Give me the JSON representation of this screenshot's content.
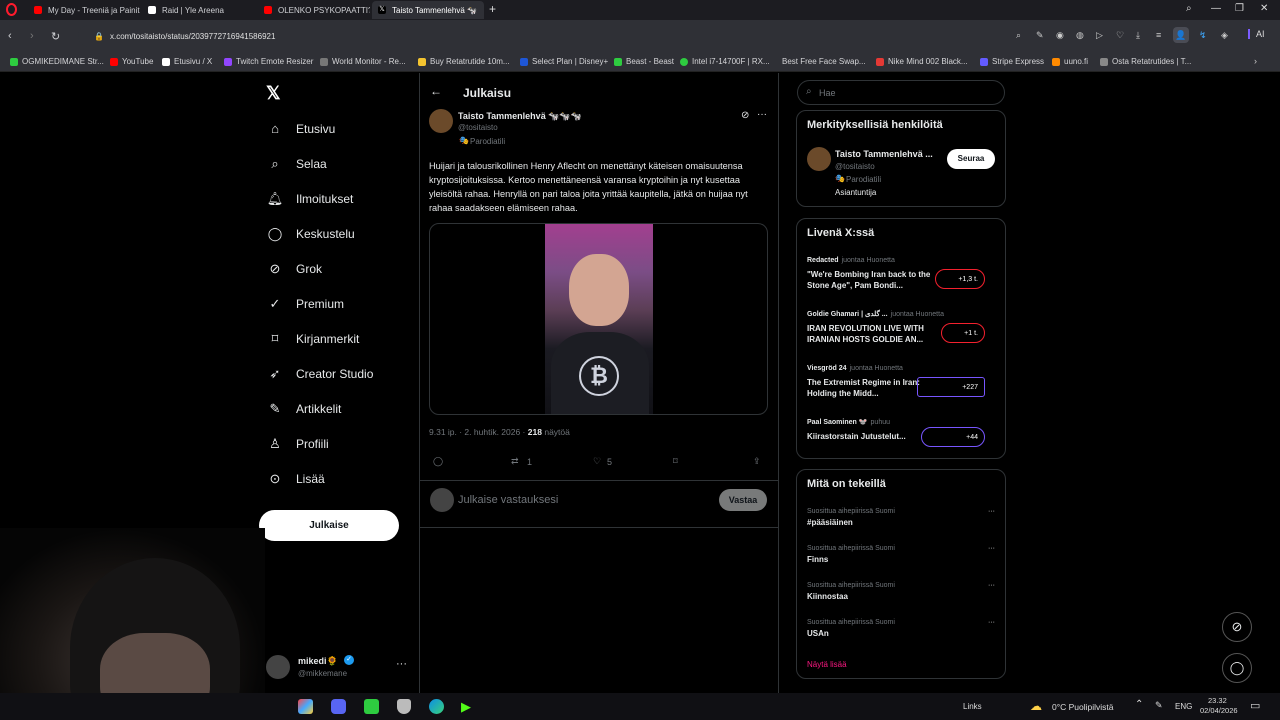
{
  "browser": {
    "tabs": [
      {
        "title": "My Day - Treeniä ja Painit...",
        "active": false
      },
      {
        "title": "Raid | Yle Areena",
        "active": false
      },
      {
        "title": "OLENKO PSYKOPAATTI? f...",
        "active": false
      },
      {
        "title": "Taisto Tammenlehvä 🐄",
        "active": true
      }
    ],
    "url": "x.com/tositaisto/status/2039772716941586921",
    "bookmarks": [
      "OGMIKEDIMANE Str...",
      "YouTube",
      "Etusivu / X",
      "Twitch Emote Resizer",
      "World Monitor - Re...",
      "Buy Retatrutide 10m...",
      "Select Plan | Disney+",
      "Beast - Beast",
      "Intel i7-14700F | RX...",
      "Best Free Face Swap...",
      "Nike Mind 002 Black...",
      "Stripe Express",
      "uuno.fi",
      "Osta Retatrutides | T..."
    ]
  },
  "sidebar": {
    "items": [
      {
        "label": "Etusivu",
        "icon": "home-icon"
      },
      {
        "label": "Selaa",
        "icon": "search-icon"
      },
      {
        "label": "Ilmoitukset",
        "icon": "bell-icon"
      },
      {
        "label": "Keskustelu",
        "icon": "chat-icon"
      },
      {
        "label": "Grok",
        "icon": "grok-icon"
      },
      {
        "label": "Premium",
        "icon": "premium-icon"
      },
      {
        "label": "Kirjanmerkit",
        "icon": "bookmark-icon"
      },
      {
        "label": "Creator Studio",
        "icon": "rocket-icon"
      },
      {
        "label": "Artikkelit",
        "icon": "article-icon"
      },
      {
        "label": "Profiili",
        "icon": "profile-icon"
      },
      {
        "label": "Lisää",
        "icon": "more-icon"
      }
    ],
    "post_button": "Julkaise",
    "account_name": "mikedi🌻",
    "account_handle": "@mikkemane"
  },
  "main": {
    "header": "Julkaisu",
    "author_name": "Taisto Tammenlehvä 🐄🐄🐄",
    "author_handle": "@tositaisto",
    "author_badge": "Parodiatili",
    "text": "Huijari ja talousrikollinen Henry Aflecht on menettänyt käteisen omaisuutensa kryptosijoituksissa. Kertoo menettäneensä varansa kryptoihin ja nyt kusettaa yleisöltä rahaa. Henryllä on pari taloa joita yrittää kaupitella, jätkä on huijaa nyt  rahaa saadakseen elämiseen rahaa.",
    "timestamp": "9.31 ip. · 2. huhtik. 2026 ·",
    "views_count": "218",
    "views_label": "näytöä",
    "actions": {
      "replies": "",
      "reposts": "1",
      "likes": "5"
    },
    "reply_placeholder": "Julkaise vastauksesi",
    "reply_button": "Vastaa"
  },
  "right": {
    "search_placeholder": "Hae",
    "relevant_title": "Merkityksellisiä henkilöitä",
    "relevant_person": {
      "name": "Taisto Tammenlehvä ...",
      "handle": "@tositaisto",
      "badge": "Parodiatili",
      "bio": "Asiantuntija",
      "follow": "Seuraa"
    },
    "live_title": "Livenä X:ssä",
    "live": [
      {
        "host": "Redacted",
        "status": "juontaa Huonetta",
        "title": "\"We're Bombing Iran back to the Stone Age\", Pam Bondi...",
        "count": "+1,3 t."
      },
      {
        "host": "Goldie Ghamari | گلدی ...",
        "status": "juontaa Huonetta",
        "title": "IRAN REVOLUTION LIVE WITH IRANIAN HOSTS GOLDIE AN...",
        "count": "+1 t."
      },
      {
        "host": "Viesgröd 24",
        "status": "juontaa Huonetta",
        "title": "The Extremist Regime in Iran: Holding the Midd...",
        "count": "+227"
      },
      {
        "host": "Paal Saominen 🐭",
        "status": "puhuu",
        "title": "Kiirastorstain Jutustelut...",
        "count": "+44"
      }
    ],
    "whats_title": "Mitä on tekeillä",
    "trends": [
      {
        "context": "Suosittua aihepiirissä Suomi",
        "name": "#pääsiäinen"
      },
      {
        "context": "Suosittua aihepiirissä Suomi",
        "name": "Finns"
      },
      {
        "context": "Suosittua aihepiirissä Suomi",
        "name": "Kiinnostaa"
      },
      {
        "context": "Suosittua aihepiirissä Suomi",
        "name": "USAn"
      }
    ],
    "show_more": "Näytä lisää"
  },
  "taskbar": {
    "links": "Links",
    "weather": "0°C  Puolipilvistä",
    "lang": "ENG",
    "time": "23.32",
    "date": "02/04/2026"
  },
  "colors": {
    "accent": "#1d9bf0",
    "live_purple": "#7856ff",
    "show_more": "#f91880"
  }
}
